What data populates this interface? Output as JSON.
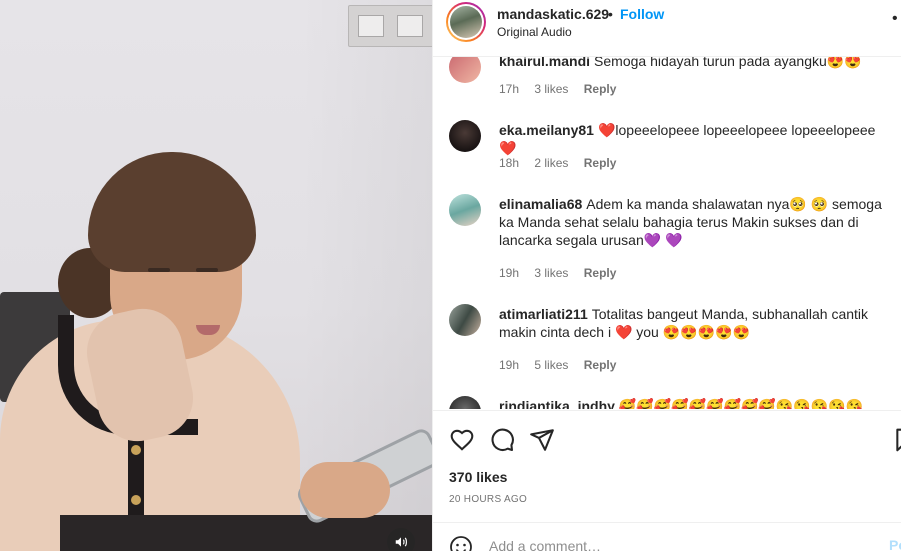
{
  "post": {
    "username": "mandaskatic.629",
    "separator": "•",
    "follow_label": "Follow",
    "audio": "Original Audio",
    "more_icon": "more-dots-icon"
  },
  "comments": [
    {
      "user": "khairul.mandi",
      "text": "Semoga hidayah turun pada ayangku😍😍",
      "time": "17h",
      "likes": "3 likes",
      "reply": "Reply"
    },
    {
      "user": "eka.meilany81",
      "text": "❤️lopeeelopeee lopeeelopeee lopeeelopeee❤️",
      "time": "18h",
      "likes": "2 likes",
      "reply": "Reply"
    },
    {
      "user": "elinamalia68",
      "text": "Adem ka manda shalawatan nya🥺 🥺 semoga ka Manda sehat selalu bahagia terus Makin sukses dan di lancarka segala urusan💜 💜",
      "time": "19h",
      "likes": "3 likes",
      "reply": "Reply"
    },
    {
      "user": "atimarliati211",
      "text": "Totalitas bangeut Manda, subhanallah cantik makin cinta dech i ❤️ you 😍😍😍😍😍",
      "time": "19h",
      "likes": "5 likes",
      "reply": "Reply"
    },
    {
      "user": "rindiantika_indhy",
      "text": "🥰🥰🥰🥰🥰🥰🥰🥰🥰😘😘😘😘😘"
    }
  ],
  "actions": {
    "likes": "370 likes",
    "time_ago": "20 HOURS AGO"
  },
  "add_comment": {
    "placeholder": "Add a comment…",
    "post_label": "Post"
  },
  "colors": {
    "accent": "#0095f6",
    "text": "#262626",
    "muted": "#737373",
    "border": "#efefef"
  }
}
